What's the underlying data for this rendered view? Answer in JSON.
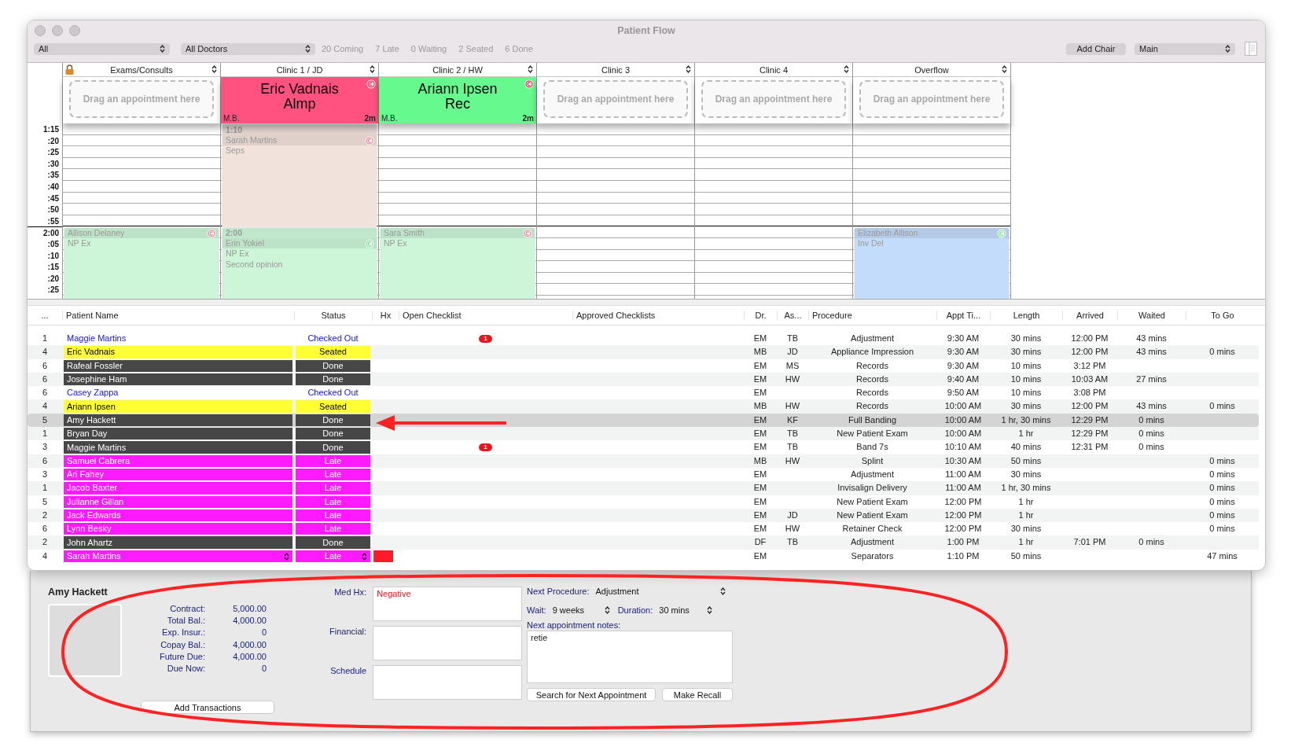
{
  "window": {
    "title": "Patient Flow"
  },
  "toolbar": {
    "filters": [
      "All",
      "All Doctors"
    ],
    "counts": [
      "20 Coming",
      "7 Late",
      "0 Waiting",
      "2 Seated",
      "6 Done"
    ],
    "add_chair": "Add Chair",
    "view": "Main"
  },
  "schedule": {
    "times": [
      "1:15",
      ":20",
      ":25",
      ":30",
      ":35",
      ":40",
      ":45",
      ":50",
      ":55",
      "2:00",
      ":05",
      ":10",
      ":15",
      ":20",
      ":25"
    ],
    "chairs": [
      {
        "header": "Exams/Consults",
        "locked": true,
        "card": {
          "kind": "drop",
          "text": "Drag an appointment here"
        },
        "appointments": [
          {
            "starts_at_hour": true,
            "color": "#cdf6d8",
            "confirmed": false,
            "lines": [
              "Allison Delaney",
              "NP Ex"
            ]
          }
        ]
      },
      {
        "header": "Clinic 1 / JD",
        "card": {
          "kind": "patient",
          "name": "Eric Vadnais",
          "procedure": "Almp",
          "doctor": "M.B.",
          "elapsed": "2m",
          "color": "#ff5280"
        },
        "appointments": [
          {
            "starts_at_hour": false,
            "color": "#f2e2dc",
            "confirmed": false,
            "time": "1:10",
            "lines": [
              "Sarah Martins",
              "Seps"
            ]
          },
          {
            "starts_at_hour": true,
            "color": "#cdf6d8",
            "confirmed": true,
            "time": "2:00",
            "lines": [
              "Erin Yokiel",
              "NP Ex",
              "Second opinion"
            ]
          }
        ]
      },
      {
        "header": "Clinic 2 / HW",
        "card": {
          "kind": "patient",
          "name": "Ariann Ipsen",
          "procedure": "Rec",
          "doctor": "M.B.",
          "elapsed": "2m",
          "color": "#66fa8e"
        },
        "appointments": [
          {
            "starts_at_hour": true,
            "color": "#cdf6d8",
            "confirmed": false,
            "lines": [
              "Sara Smith",
              "NP Ex"
            ]
          }
        ]
      },
      {
        "header": "Clinic 3",
        "card": {
          "kind": "drop",
          "text": "Drag an appointment here"
        }
      },
      {
        "header": "Clinic 4",
        "card": {
          "kind": "drop",
          "text": "Drag an appointment here"
        }
      },
      {
        "header": "Overflow",
        "card": {
          "kind": "drop",
          "text": "Drag an appointment here"
        },
        "appointments": [
          {
            "starts_at_hour": true,
            "color": "#c4dcfb",
            "confirmed": true,
            "lines": [
              "Elizabeth Allison",
              "Inv Del"
            ]
          }
        ]
      }
    ]
  },
  "table": {
    "columns": [
      "...",
      "Patient Name",
      "Status",
      "Hx",
      "Open Checklist",
      "Approved Checklists",
      "Dr.",
      "As...",
      "Procedure",
      "Appt Ti...",
      "Length",
      "Arrived",
      "Waited",
      "To Go"
    ],
    "rows": [
      {
        "no": "1",
        "name": "Maggie Martins",
        "status": "Checked Out",
        "kind": "checked_out",
        "selected": false,
        "hx": false,
        "checklist": "1",
        "dr": "EM",
        "as": "TB",
        "procedure": "Adjustment",
        "appt": "9:30 AM",
        "length": "30 mins",
        "arrived": "12:00 PM",
        "waited": "43 mins",
        "to_go": ""
      },
      {
        "no": "4",
        "name": "Eric Vadnais",
        "status": "Seated",
        "kind": "seated",
        "selected": false,
        "hx": false,
        "dr": "MB",
        "as": "JD",
        "procedure": "Appliance Impression",
        "appt": "9:30 AM",
        "length": "30 mins",
        "arrived": "12:00 PM",
        "waited": "43 mins",
        "to_go": "0 mins"
      },
      {
        "no": "6",
        "name": "Rafeal Fossler",
        "status": "Done",
        "kind": "done",
        "selected": false,
        "hx": false,
        "dr": "EM",
        "as": "MS",
        "procedure": "Records",
        "appt": "9:30 AM",
        "length": "10 mins",
        "arrived": "3:12 PM",
        "waited": "",
        "to_go": ""
      },
      {
        "no": "6",
        "name": "Josephine Ham",
        "status": "Done",
        "kind": "done",
        "selected": false,
        "hx": false,
        "dr": "EM",
        "as": "HW",
        "procedure": "Records",
        "appt": "9:40 AM",
        "length": "10 mins",
        "arrived": "10:03 AM",
        "waited": "27 mins",
        "to_go": ""
      },
      {
        "no": "6",
        "name": "Casey Zappa",
        "status": "Checked Out",
        "kind": "checked_out",
        "selected": false,
        "hx": false,
        "dr": "EM",
        "as": "",
        "procedure": "Records",
        "appt": "9:50 AM",
        "length": "10 mins",
        "arrived": "3:08 PM",
        "waited": "",
        "to_go": ""
      },
      {
        "no": "4",
        "name": "Ariann Ipsen",
        "status": "Seated",
        "kind": "seated",
        "selected": false,
        "hx": false,
        "dr": "MB",
        "as": "HW",
        "procedure": "Records",
        "appt": "10:00 AM",
        "length": "30 mins",
        "arrived": "12:00 PM",
        "waited": "43 mins",
        "to_go": "0 mins"
      },
      {
        "no": "5",
        "name": "Amy Hackett",
        "status": "Done",
        "kind": "done",
        "selected": true,
        "hx": false,
        "dr": "EM",
        "as": "KF",
        "procedure": "Full Banding",
        "appt": "10:00 AM",
        "length": "1 hr, 30 mins",
        "arrived": "12:29 PM",
        "waited": "0 mins",
        "to_go": ""
      },
      {
        "no": "1",
        "name": "Bryan Day",
        "status": "Done",
        "kind": "done",
        "selected": false,
        "hx": false,
        "dr": "EM",
        "as": "TB",
        "procedure": "New Patient Exam",
        "appt": "10:00 AM",
        "length": "1 hr",
        "arrived": "12:29 PM",
        "waited": "0 mins",
        "to_go": ""
      },
      {
        "no": "3",
        "name": "Maggie Martins",
        "status": "Done",
        "kind": "done",
        "selected": false,
        "hx": false,
        "checklist": "1",
        "dr": "EM",
        "as": "TB",
        "procedure": "Band 7s",
        "appt": "10:10 AM",
        "length": "40 mins",
        "arrived": "12:31 PM",
        "waited": "0 mins",
        "to_go": ""
      },
      {
        "no": "6",
        "name": "Samuel Cabrera",
        "status": "Late",
        "kind": "late",
        "selected": false,
        "hx": false,
        "dr": "MB",
        "as": "HW",
        "procedure": "Splint",
        "appt": "10:30 AM",
        "length": "50 mins",
        "arrived": "",
        "waited": "",
        "to_go": "0 mins"
      },
      {
        "no": "3",
        "name": "Ari Fahey",
        "status": "Late",
        "kind": "late",
        "selected": false,
        "hx": false,
        "dr": "EM",
        "as": "",
        "procedure": "Adjustment",
        "appt": "11:00 AM",
        "length": "30 mins",
        "arrived": "",
        "waited": "",
        "to_go": "0 mins"
      },
      {
        "no": "1",
        "name": "Jacob Baxter",
        "status": "Late",
        "kind": "late",
        "selected": false,
        "hx": false,
        "dr": "EM",
        "as": "",
        "procedure": "Invisalign Delivery",
        "appt": "11:00 AM",
        "length": "1 hr, 30 mins",
        "arrived": "",
        "waited": "",
        "to_go": "0 mins"
      },
      {
        "no": "5",
        "name": "Julianne Gillan",
        "status": "Late",
        "kind": "late",
        "selected": false,
        "hx": false,
        "dr": "EM",
        "as": "",
        "procedure": "New Patient Exam",
        "appt": "12:00 PM",
        "length": "1 hr",
        "arrived": "",
        "waited": "",
        "to_go": "0 mins"
      },
      {
        "no": "2",
        "name": "Jack Edwards",
        "status": "Late",
        "kind": "late",
        "selected": false,
        "hx": false,
        "dr": "EM",
        "as": "JD",
        "procedure": "New Patient Exam",
        "appt": "12:00 PM",
        "length": "1 hr",
        "arrived": "",
        "waited": "",
        "to_go": "0 mins"
      },
      {
        "no": "6",
        "name": "Lynn Besky",
        "status": "Late",
        "kind": "late",
        "selected": false,
        "hx": false,
        "dr": "EM",
        "as": "HW",
        "procedure": "Retainer Check",
        "appt": "12:00 PM",
        "length": "30 mins",
        "arrived": "",
        "waited": "",
        "to_go": "0 mins"
      },
      {
        "no": "2",
        "name": "John Ahartz",
        "status": "Done",
        "kind": "done",
        "selected": false,
        "hx": false,
        "dr": "DF",
        "as": "TB",
        "procedure": "Adjustment",
        "appt": "1:00 PM",
        "length": "1 hr",
        "arrived": "7:01 PM",
        "waited": "0 mins",
        "to_go": ""
      },
      {
        "no": "4",
        "name": "Sarah Martins",
        "status": "Late",
        "kind": "late",
        "selected": false,
        "hx": true,
        "editing": true,
        "dr": "EM",
        "as": "",
        "procedure": "Separators",
        "appt": "1:10 PM",
        "length": "50 mins",
        "arrived": "",
        "waited": "",
        "to_go": "47 mins"
      }
    ]
  },
  "detail": {
    "patient": "Amy Hackett",
    "finance": [
      {
        "label": "Contract:",
        "value": "5,000.00"
      },
      {
        "label": "Total Bal.:",
        "value": "4,000.00"
      },
      {
        "label": "Exp. Insur.:",
        "value": "0"
      },
      {
        "label": "Copay Bal.:",
        "value": "4,000.00"
      },
      {
        "label": "Future Due:",
        "value": "4,000.00"
      },
      {
        "label": "Due Now:",
        "value": "0"
      }
    ],
    "add_transactions": "Add Transactions",
    "notes": [
      {
        "label": "Med Hx:",
        "value": "Negative"
      },
      {
        "label": "Financial:"
      },
      {
        "label": "Schedule"
      }
    ],
    "next_procedure": {
      "label": "Next Procedure:",
      "value": "Adjustment"
    },
    "wait": {
      "label": "Wait:",
      "value": "9 weeks"
    },
    "duration": {
      "label": "Duration:",
      "value": "30 mins"
    },
    "notes_label": "Next appointment notes:",
    "notes_value": "retie",
    "buttons": [
      "Search for Next Appointment",
      "Make Recall"
    ]
  }
}
